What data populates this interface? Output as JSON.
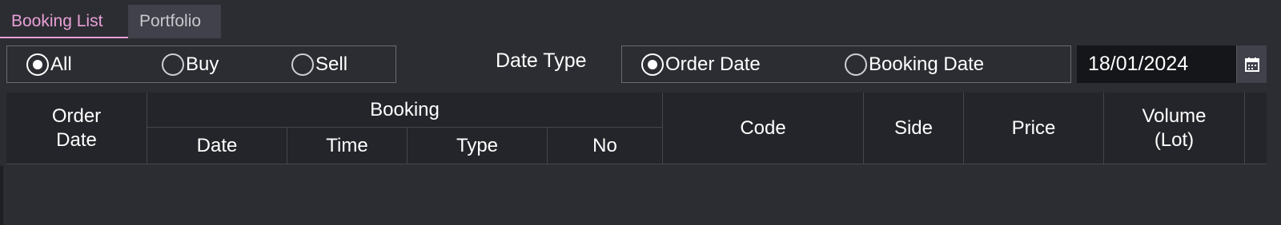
{
  "tabs": [
    {
      "label": "Booking List",
      "active": true
    },
    {
      "label": "Portfolio",
      "active": false
    }
  ],
  "side_filter": {
    "options": [
      {
        "label": "All",
        "selected": true
      },
      {
        "label": "Buy",
        "selected": false
      },
      {
        "label": "Sell",
        "selected": false
      }
    ]
  },
  "date_type": {
    "label": "Date Type",
    "options": [
      {
        "label": "Order Date",
        "selected": true
      },
      {
        "label": "Booking Date",
        "selected": false
      }
    ]
  },
  "date_input": {
    "value": "18/01/2024",
    "icon": "calendar-icon"
  },
  "table": {
    "order_date": "Order\nDate",
    "booking_group": "Booking",
    "booking_columns": [
      "Date",
      "Time",
      "Type",
      "No"
    ],
    "code": "Code",
    "side": "Side",
    "price": "Price",
    "volume": "Volume\n(Lot)"
  },
  "colors": {
    "background": "#2c2d32",
    "header_bg": "#24252a",
    "active_tab": "#e8a0d8",
    "inactive_tab_bg": "#40414a",
    "date_input_bg": "#15161a"
  }
}
